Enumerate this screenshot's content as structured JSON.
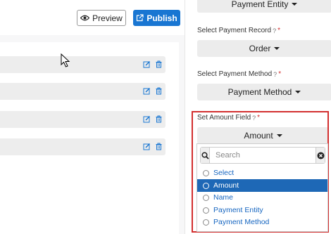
{
  "toolbar": {
    "preview_label": "Preview",
    "publish_label": "Publish"
  },
  "rows": [
    {},
    {},
    {},
    {}
  ],
  "sidebar": {
    "payment_entity": {
      "value": "Payment Entity"
    },
    "payment_record": {
      "label": "Select Payment Record",
      "required": "*",
      "value": "Order"
    },
    "payment_method": {
      "label": "Select Payment Method",
      "required": "*",
      "value": "Payment Method"
    },
    "amount_field": {
      "label": "Set Amount Field",
      "required": "*",
      "value": "Amount"
    }
  },
  "dropdown": {
    "search_placeholder": "Search",
    "options": [
      "Select",
      "Amount",
      "Name",
      "Payment Entity",
      "Payment Method"
    ],
    "selected": "Amount"
  },
  "colors": {
    "accent": "#1976d2",
    "highlight": "#d32f2f",
    "selected": "#1e68b6"
  }
}
